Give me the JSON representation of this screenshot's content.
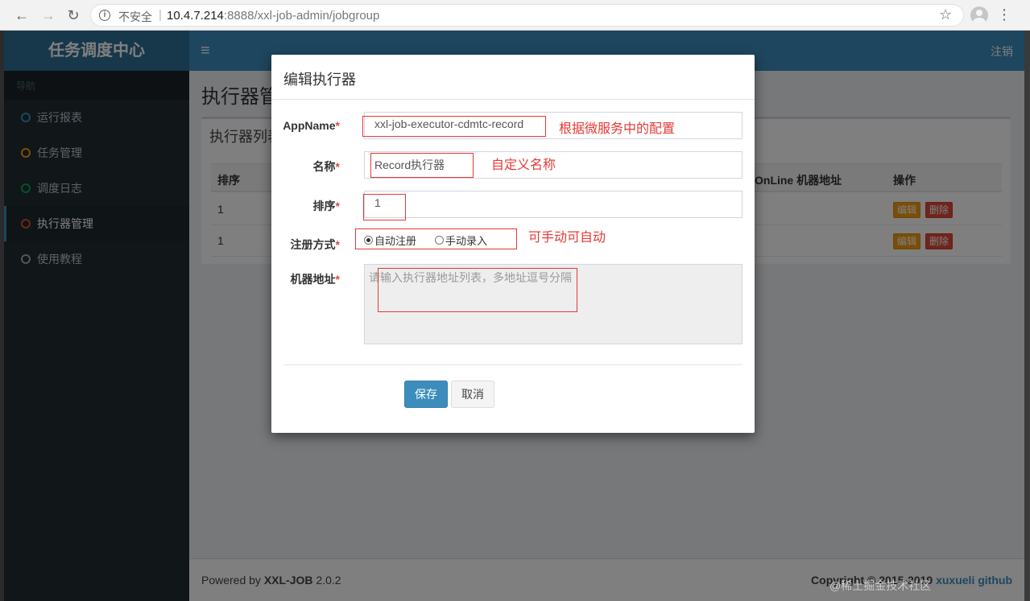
{
  "browser": {
    "insecure_label": "不安全",
    "url_host": "10.4.7.214",
    "url_path": ":8888/xxl-job-admin/jobgroup"
  },
  "app": {
    "logo": "任务调度中心",
    "logout": "注销",
    "nav_header": "导航",
    "nav_items": [
      {
        "label": "运行报表",
        "color": "#3c8dbc"
      },
      {
        "label": "任务管理",
        "color": "#f39c12"
      },
      {
        "label": "调度日志",
        "color": "#00a65a"
      },
      {
        "label": "执行器管理",
        "color": "#dd4b39"
      },
      {
        "label": "使用教程",
        "color": "#aaaaaa"
      }
    ],
    "page_title": "执行器管理",
    "box_title": "执行器列表",
    "table": {
      "headers": [
        "排序",
        "OnLine 机器地址",
        "操作"
      ],
      "rows": [
        {
          "order": "1",
          "edit": "编辑",
          "delete": "删除"
        },
        {
          "order": "1",
          "edit": "编辑",
          "delete": "删除"
        }
      ]
    },
    "footer": {
      "powered_by": "Powered by ",
      "product": "XXL-JOB",
      "version": " 2.0.2",
      "copyright": "Copyright © 2015-2019 ",
      "author": "xuxueli",
      "link": "github"
    }
  },
  "modal": {
    "title": "编辑执行器",
    "fields": {
      "appname_label": "AppName",
      "appname_value": "xxl-job-executor-cdmtc-record",
      "name_label": "名称",
      "name_value": "Record执行器",
      "order_label": "排序",
      "order_value": "1",
      "reg_label": "注册方式",
      "reg_auto": "自动注册",
      "reg_manual": "手动录入",
      "address_label": "机器地址",
      "address_placeholder": "请输入执行器地址列表，多地址逗号分隔"
    },
    "save": "保存",
    "cancel": "取消"
  },
  "annotations": {
    "appname_note": "根据微服务中的配置",
    "name_note": "自定义名称",
    "reg_note": "可手动可自动"
  },
  "watermark": "@稀土掘金技术社区",
  "colors": {
    "primary": "#3c8dbc",
    "annotation_red": "#e53935",
    "edit_btn": "#f39c12",
    "delete_btn": "#dd4b39"
  }
}
